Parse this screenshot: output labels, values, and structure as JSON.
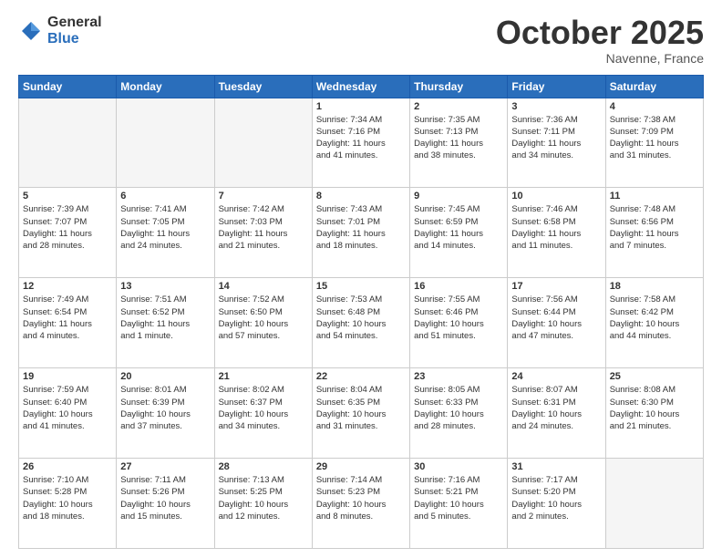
{
  "logo": {
    "general": "General",
    "blue": "Blue"
  },
  "header": {
    "month": "October 2025",
    "location": "Navenne, France"
  },
  "weekdays": [
    "Sunday",
    "Monday",
    "Tuesday",
    "Wednesday",
    "Thursday",
    "Friday",
    "Saturday"
  ],
  "weeks": [
    [
      {
        "day": "",
        "info": ""
      },
      {
        "day": "",
        "info": ""
      },
      {
        "day": "",
        "info": ""
      },
      {
        "day": "1",
        "info": "Sunrise: 7:34 AM\nSunset: 7:16 PM\nDaylight: 11 hours\nand 41 minutes."
      },
      {
        "day": "2",
        "info": "Sunrise: 7:35 AM\nSunset: 7:13 PM\nDaylight: 11 hours\nand 38 minutes."
      },
      {
        "day": "3",
        "info": "Sunrise: 7:36 AM\nSunset: 7:11 PM\nDaylight: 11 hours\nand 34 minutes."
      },
      {
        "day": "4",
        "info": "Sunrise: 7:38 AM\nSunset: 7:09 PM\nDaylight: 11 hours\nand 31 minutes."
      }
    ],
    [
      {
        "day": "5",
        "info": "Sunrise: 7:39 AM\nSunset: 7:07 PM\nDaylight: 11 hours\nand 28 minutes."
      },
      {
        "day": "6",
        "info": "Sunrise: 7:41 AM\nSunset: 7:05 PM\nDaylight: 11 hours\nand 24 minutes."
      },
      {
        "day": "7",
        "info": "Sunrise: 7:42 AM\nSunset: 7:03 PM\nDaylight: 11 hours\nand 21 minutes."
      },
      {
        "day": "8",
        "info": "Sunrise: 7:43 AM\nSunset: 7:01 PM\nDaylight: 11 hours\nand 18 minutes."
      },
      {
        "day": "9",
        "info": "Sunrise: 7:45 AM\nSunset: 6:59 PM\nDaylight: 11 hours\nand 14 minutes."
      },
      {
        "day": "10",
        "info": "Sunrise: 7:46 AM\nSunset: 6:58 PM\nDaylight: 11 hours\nand 11 minutes."
      },
      {
        "day": "11",
        "info": "Sunrise: 7:48 AM\nSunset: 6:56 PM\nDaylight: 11 hours\nand 7 minutes."
      }
    ],
    [
      {
        "day": "12",
        "info": "Sunrise: 7:49 AM\nSunset: 6:54 PM\nDaylight: 11 hours\nand 4 minutes."
      },
      {
        "day": "13",
        "info": "Sunrise: 7:51 AM\nSunset: 6:52 PM\nDaylight: 11 hours\nand 1 minute."
      },
      {
        "day": "14",
        "info": "Sunrise: 7:52 AM\nSunset: 6:50 PM\nDaylight: 10 hours\nand 57 minutes."
      },
      {
        "day": "15",
        "info": "Sunrise: 7:53 AM\nSunset: 6:48 PM\nDaylight: 10 hours\nand 54 minutes."
      },
      {
        "day": "16",
        "info": "Sunrise: 7:55 AM\nSunset: 6:46 PM\nDaylight: 10 hours\nand 51 minutes."
      },
      {
        "day": "17",
        "info": "Sunrise: 7:56 AM\nSunset: 6:44 PM\nDaylight: 10 hours\nand 47 minutes."
      },
      {
        "day": "18",
        "info": "Sunrise: 7:58 AM\nSunset: 6:42 PM\nDaylight: 10 hours\nand 44 minutes."
      }
    ],
    [
      {
        "day": "19",
        "info": "Sunrise: 7:59 AM\nSunset: 6:40 PM\nDaylight: 10 hours\nand 41 minutes."
      },
      {
        "day": "20",
        "info": "Sunrise: 8:01 AM\nSunset: 6:39 PM\nDaylight: 10 hours\nand 37 minutes."
      },
      {
        "day": "21",
        "info": "Sunrise: 8:02 AM\nSunset: 6:37 PM\nDaylight: 10 hours\nand 34 minutes."
      },
      {
        "day": "22",
        "info": "Sunrise: 8:04 AM\nSunset: 6:35 PM\nDaylight: 10 hours\nand 31 minutes."
      },
      {
        "day": "23",
        "info": "Sunrise: 8:05 AM\nSunset: 6:33 PM\nDaylight: 10 hours\nand 28 minutes."
      },
      {
        "day": "24",
        "info": "Sunrise: 8:07 AM\nSunset: 6:31 PM\nDaylight: 10 hours\nand 24 minutes."
      },
      {
        "day": "25",
        "info": "Sunrise: 8:08 AM\nSunset: 6:30 PM\nDaylight: 10 hours\nand 21 minutes."
      }
    ],
    [
      {
        "day": "26",
        "info": "Sunrise: 7:10 AM\nSunset: 5:28 PM\nDaylight: 10 hours\nand 18 minutes."
      },
      {
        "day": "27",
        "info": "Sunrise: 7:11 AM\nSunset: 5:26 PM\nDaylight: 10 hours\nand 15 minutes."
      },
      {
        "day": "28",
        "info": "Sunrise: 7:13 AM\nSunset: 5:25 PM\nDaylight: 10 hours\nand 12 minutes."
      },
      {
        "day": "29",
        "info": "Sunrise: 7:14 AM\nSunset: 5:23 PM\nDaylight: 10 hours\nand 8 minutes."
      },
      {
        "day": "30",
        "info": "Sunrise: 7:16 AM\nSunset: 5:21 PM\nDaylight: 10 hours\nand 5 minutes."
      },
      {
        "day": "31",
        "info": "Sunrise: 7:17 AM\nSunset: 5:20 PM\nDaylight: 10 hours\nand 2 minutes."
      },
      {
        "day": "",
        "info": ""
      }
    ]
  ]
}
